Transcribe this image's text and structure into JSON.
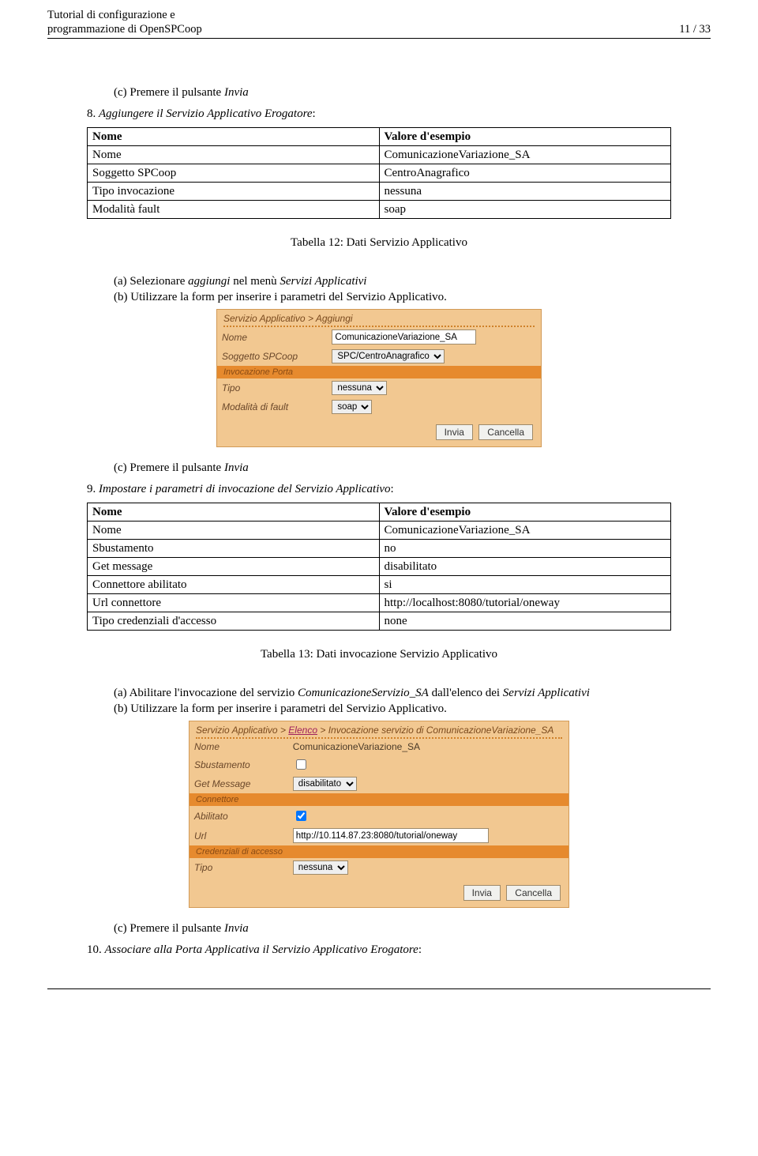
{
  "header": {
    "title_line1": "Tutorial di configurazione e",
    "title_line2": "programmazione di OpenSPCoop",
    "pager": "11 / 33"
  },
  "text": {
    "c_press_invia_pre": "(c)  Premere il pulsante ",
    "c_invia": "Invia",
    "step8_pre": "8. ",
    "step8_em": "Aggiungere il Servizio Applicativo Erogatore",
    "step8_post": ":",
    "a_pre": "(a)  Selezionare ",
    "a_em1": "aggiungi",
    "a_mid": " nel menù ",
    "a_em2": "Servizi Applicativi",
    "b_text": "(b)  Utilizzare la form per inserire i parametri del Servizio Applicativo.",
    "step9_pre": "9. ",
    "step9_em": "Impostare i parametri di invocazione del Servizio Applicativo",
    "step9_post": ":",
    "a2_pre": "(a)  Abilitare l'invocazione del servizio ",
    "a2_em1": "ComunicazioneServizio_SA",
    "a2_mid": " dall'elenco dei ",
    "a2_em2": "Servizi Applicativi",
    "b2_text": "(b)  Utilizzare la form per inserire i parametri del Servizio Applicativo.",
    "step10_pre": "10. ",
    "step10_em": "Associare alla Porta Applicativa il Servizio Applicativo Erogatore",
    "step10_post": ":"
  },
  "table12": {
    "caption": "Tabella 12: Dati Servizio Applicativo",
    "head_l": "Nome",
    "head_r": "Valore d'esempio",
    "rows": [
      {
        "l": "Nome",
        "r": "ComunicazioneVariazione_SA"
      },
      {
        "l": "Soggetto SPCoop",
        "r": "CentroAnagrafico"
      },
      {
        "l": "Tipo invocazione",
        "r": "nessuna"
      },
      {
        "l": "Modalità fault",
        "r": "soap"
      }
    ]
  },
  "table13": {
    "caption": "Tabella 13: Dati invocazione Servizio Applicativo",
    "head_l": "Nome",
    "head_r": "Valore d'esempio",
    "rows": [
      {
        "l": "Nome",
        "r": "ComunicazioneVariazione_SA"
      },
      {
        "l": "Sbustamento",
        "r": "no"
      },
      {
        "l": "Get message",
        "r": "disabilitato"
      },
      {
        "l": "Connettore abilitato",
        "r": "si"
      },
      {
        "l": "Url connettore",
        "r": "http://localhost:8080/tutorial/oneway"
      },
      {
        "l": "Tipo credenziali d'accesso",
        "r": "none"
      }
    ]
  },
  "shot1": {
    "crumb_a": "Servizio Applicativo",
    "crumb_b": "Aggiungi",
    "nome_label": "Nome",
    "nome_value": "ComunicazioneVariazione_SA",
    "sogg_label": "Soggetto SPCoop",
    "sogg_value": "SPC/CentroAnagrafico",
    "section_invporta": "Invocazione Porta",
    "tipo_label": "Tipo",
    "tipo_value": "nessuna",
    "fault_label": "Modalità di fault",
    "fault_value": "soap",
    "btn_invia": "Invia",
    "btn_cancella": "Cancella"
  },
  "shot2": {
    "crumb_a": "Servizio Applicativo",
    "crumb_link": "Elenco",
    "crumb_b": "Invocazione servizio di ComunicazioneVariazione_SA",
    "nome_label": "Nome",
    "nome_value": "ComunicazioneVariazione_SA",
    "sbus_label": "Sbustamento",
    "getm_label": "Get Message",
    "getm_value": "disabilitato",
    "section_connettore": "Connettore",
    "abil_label": "Abilitato",
    "url_label": "Url",
    "url_value": "http://10.114.87.23:8080/tutorial/oneway",
    "section_cred": "Credenziali di accesso",
    "tipo_label": "Tipo",
    "tipo_value": "nessuna",
    "btn_invia": "Invia",
    "btn_cancella": "Cancella"
  }
}
